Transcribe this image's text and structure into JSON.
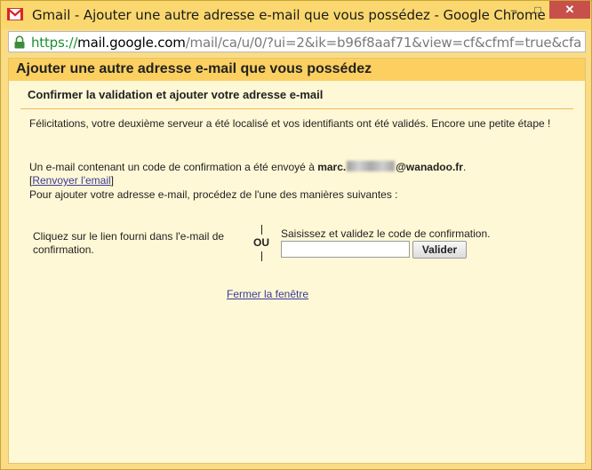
{
  "window": {
    "title": "Gmail - Ajouter une autre adresse e-mail que vous possédez - Google Chrome",
    "icon": "gmail-icon",
    "minimize_label": "–",
    "maximize_label": "□",
    "close_label": "✕"
  },
  "address_bar": {
    "scheme": "https://",
    "host": "mail.google.com",
    "path": "/mail/ca/u/0/?ui=2&ik=b96f8aaf71&view=cf&cfmf=true&cfa",
    "icon": "lock-icon"
  },
  "page": {
    "header_title": "Ajouter une autre adresse e-mail que vous possédez",
    "subheader": "Confirmer la validation et ajouter votre adresse e-mail",
    "congrats_text": "Félicitations, votre deuxième serveur a été localisé et vos identifiants ont été validés. Encore une petite étape !",
    "sent_text_prefix": "Un e-mail contenant un code de confirmation a été envoyé à ",
    "email_start": "marc.",
    "email_end": "@wanadoo.fr",
    "sent_text_suffix": ".",
    "resend_open": "[",
    "resend_link": "Renvoyer l'email",
    "resend_close": "]",
    "instructions": "Pour ajouter votre adresse e-mail, procédez de l'une des manières suivantes :",
    "option_link_text": "Cliquez sur le lien fourni dans l'e-mail de confirmation.",
    "or_label": "OU",
    "option_code_text": "Saisissez et validez le code de confirmation.",
    "code_input_value": "",
    "validate_button": "Valider",
    "close_window_link": "Fermer la fenêtre"
  }
}
